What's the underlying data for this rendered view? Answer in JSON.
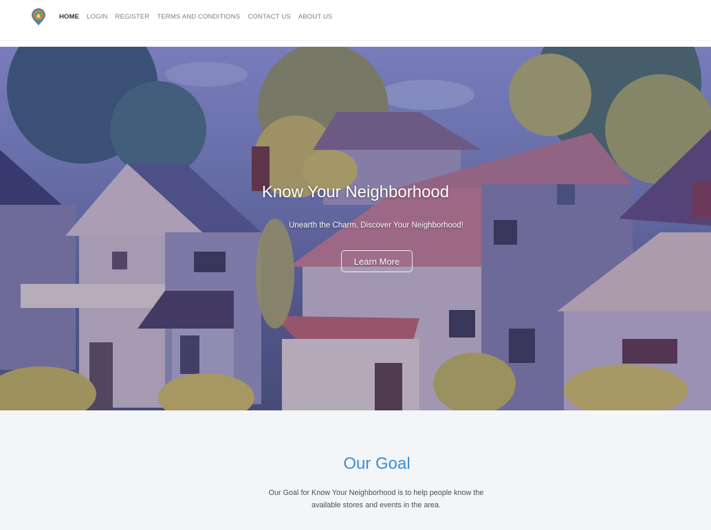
{
  "nav": {
    "logo_icon": "neighborhood-pin-logo",
    "links": [
      {
        "label": "HOME",
        "active": true
      },
      {
        "label": "LOGIN",
        "active": false
      },
      {
        "label": "REGISTER",
        "active": false
      },
      {
        "label": "TERMS AND CONDITIONS",
        "active": false
      },
      {
        "label": "CONTACT US",
        "active": false
      },
      {
        "label": "ABOUT US",
        "active": false
      }
    ]
  },
  "hero": {
    "title": "Know Your Neighborhood",
    "subtitle": "Unearth the Charm, Discover Your Neighborhood!",
    "button_label": "Learn More"
  },
  "goal": {
    "title": "Our Goal",
    "text": "Our Goal for Know Your Neighborhood is to help people know the available stores and events in the area."
  },
  "colors": {
    "accent": "#3a8fd4",
    "nav_active": "#2f3236",
    "nav_text": "#7a7f86",
    "section_bg": "#f4f5f6"
  }
}
